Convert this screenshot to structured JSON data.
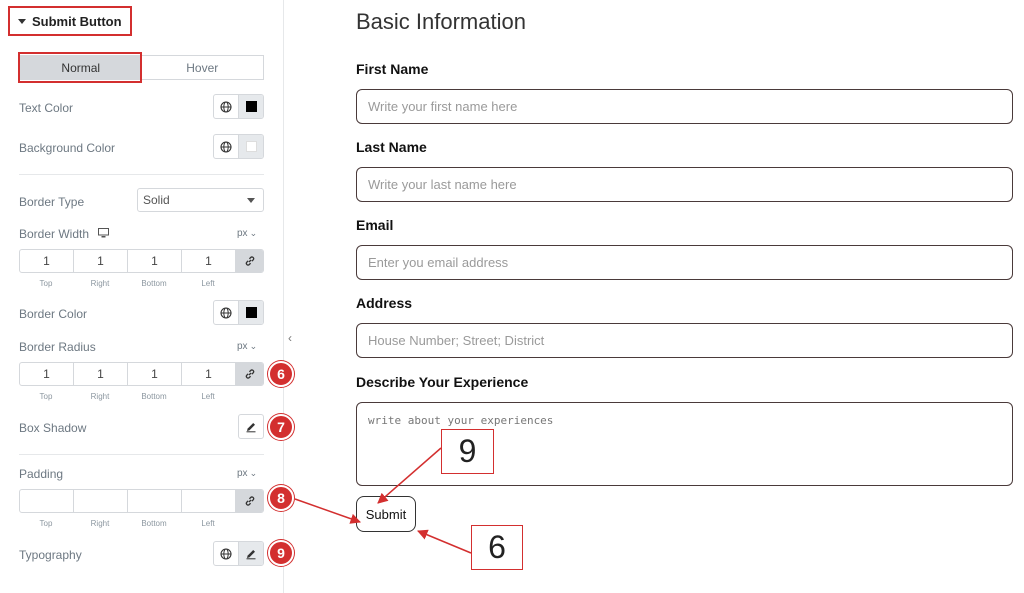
{
  "panel": {
    "section_title": "Submit Button",
    "tabs": [
      {
        "label": "Normal",
        "active": true
      },
      {
        "label": "Hover",
        "active": false
      }
    ],
    "text_color": {
      "label": "Text Color",
      "value": "#000000"
    },
    "background_color": {
      "label": "Background Color",
      "value": "#FFFFFF"
    },
    "border_type": {
      "label": "Border Type",
      "value": "Solid"
    },
    "border_width": {
      "label": "Border Width",
      "unit": "px",
      "values": [
        "1",
        "1",
        "1",
        "1"
      ],
      "sides": [
        "Top",
        "Right",
        "Bottom",
        "Left"
      ]
    },
    "border_color": {
      "label": "Border Color",
      "value": "#000000"
    },
    "border_radius": {
      "label": "Border Radius",
      "unit": "px",
      "values": [
        "1",
        "1",
        "1",
        "1"
      ],
      "sides": [
        "Top",
        "Right",
        "Bottom",
        "Left"
      ]
    },
    "box_shadow": {
      "label": "Box Shadow"
    },
    "padding": {
      "label": "Padding",
      "unit": "px",
      "values": [
        "",
        "",
        "",
        ""
      ],
      "sides": [
        "Top",
        "Right",
        "Bottom",
        "Left"
      ]
    },
    "typography": {
      "label": "Typography"
    },
    "markers": [
      "6",
      "7",
      "8",
      "9"
    ]
  },
  "form": {
    "title": "Basic Information",
    "fields": [
      {
        "label": "First Name",
        "placeholder": "Write your first name here"
      },
      {
        "label": "Last Name",
        "placeholder": "Write your  last name here"
      },
      {
        "label": "Email",
        "placeholder": "Enter you email address"
      },
      {
        "label": "Address",
        "placeholder": "House Number; Street; District"
      }
    ],
    "experience": {
      "label": "Describe Your Experience",
      "placeholder": "write about your experiences"
    },
    "submit_label": "Submit"
  },
  "callouts": [
    "9",
    "6"
  ],
  "colors": {
    "accent": "#D32F2F",
    "control_bg": "#D5D8DC"
  }
}
